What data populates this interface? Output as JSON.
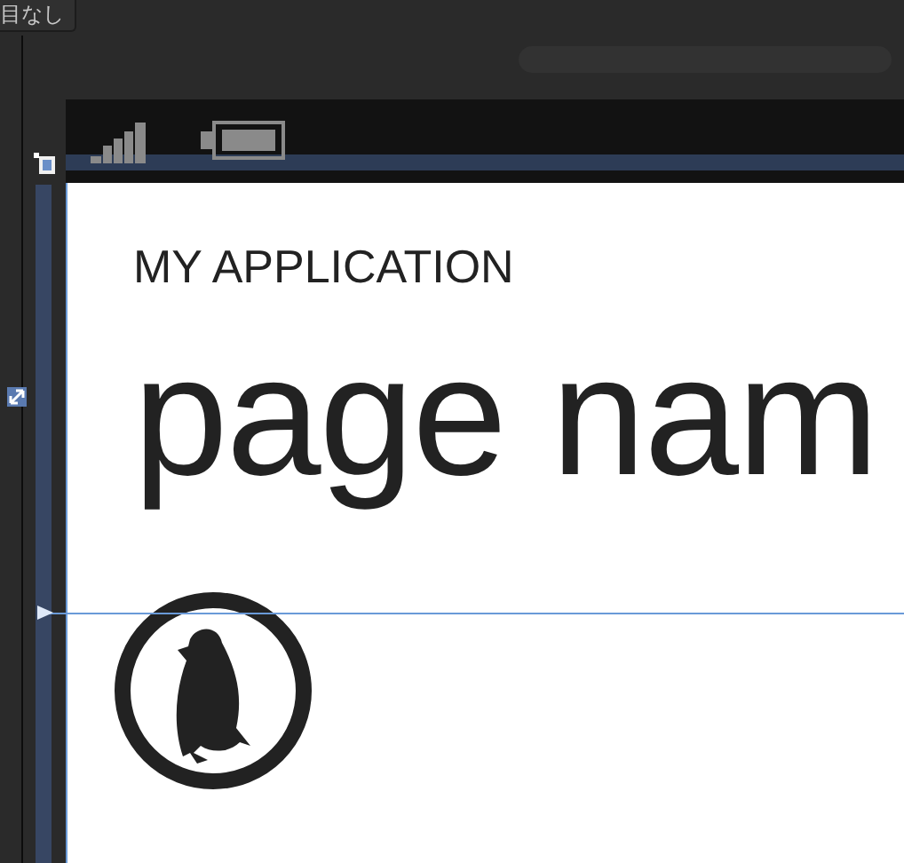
{
  "tooltip": {
    "text": "目なし"
  },
  "phone": {
    "app_title": "MY APPLICATION",
    "page_title": "page nam"
  }
}
